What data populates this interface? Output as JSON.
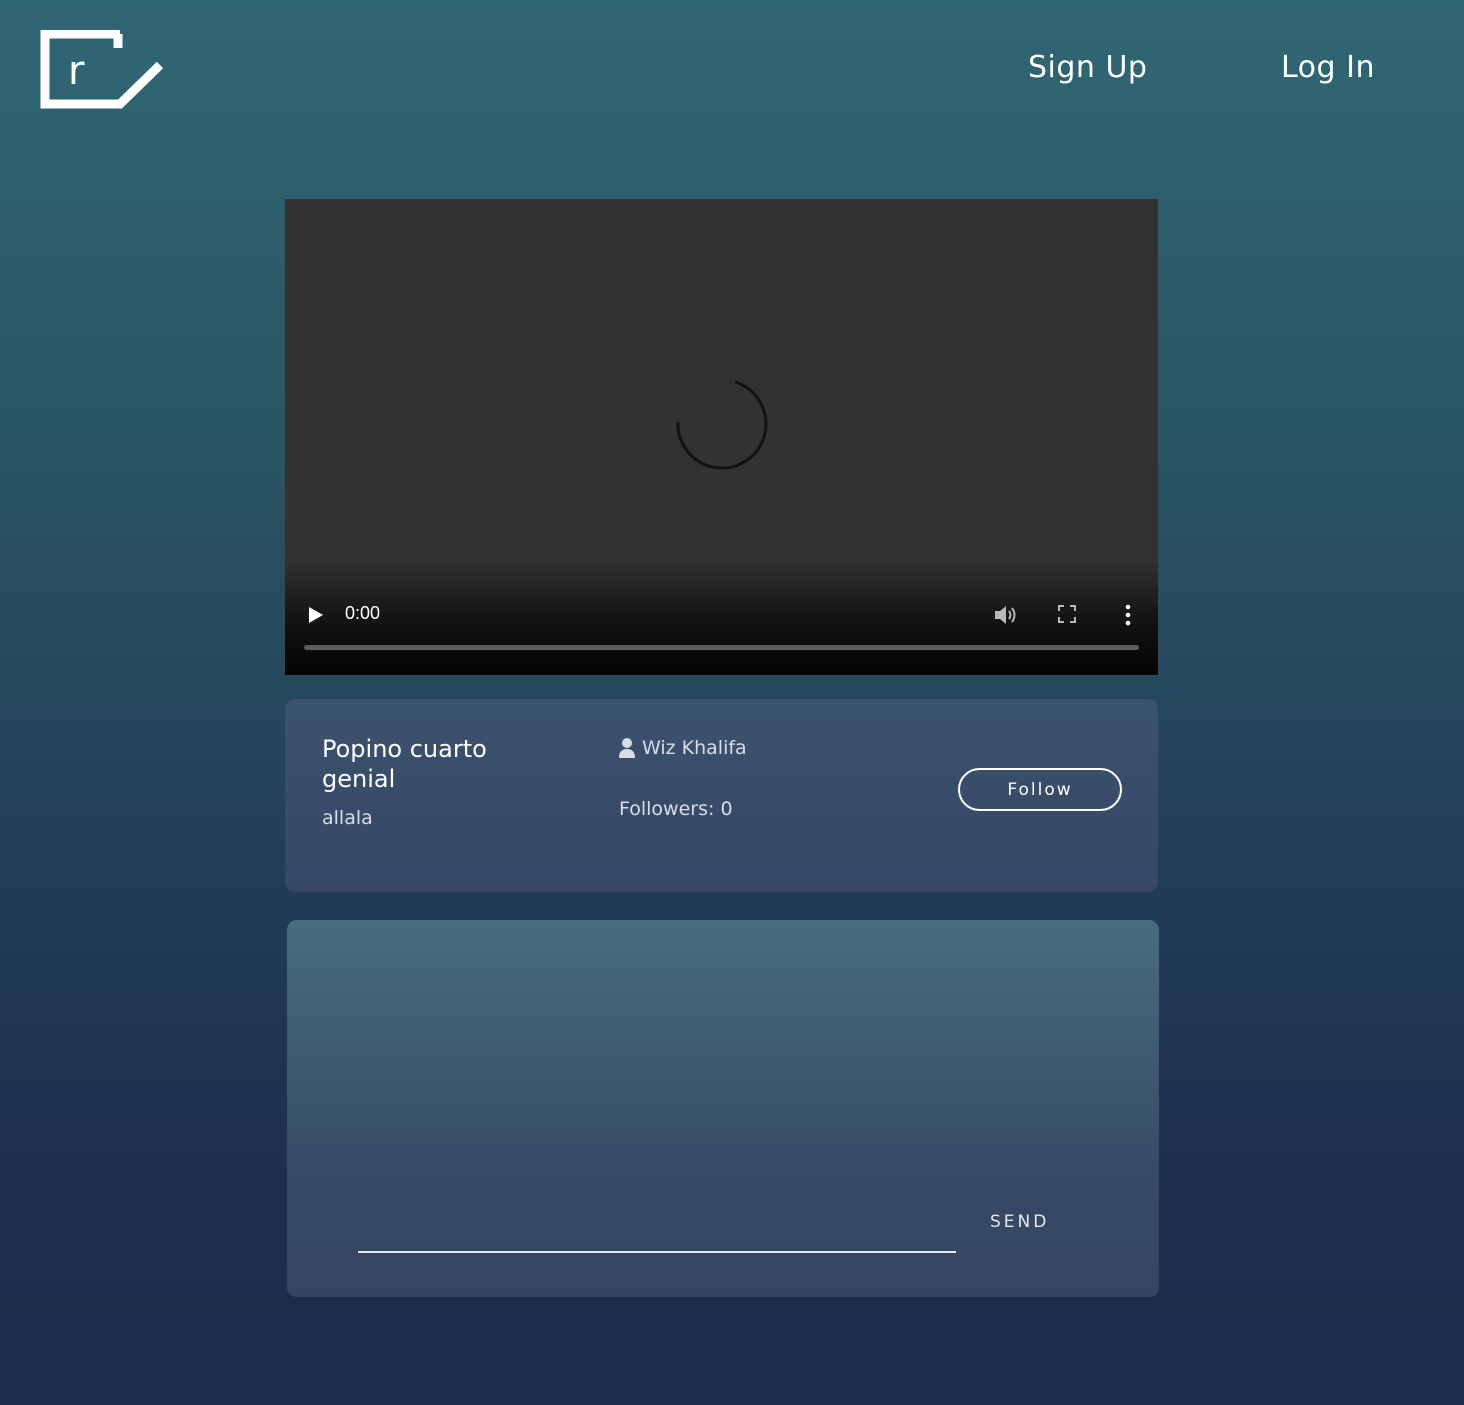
{
  "header": {
    "logo_icon": "brand-logo-icon",
    "signup_label": "Sign Up",
    "login_label": "Log In"
  },
  "video_player": {
    "state": "loading",
    "current_time": "0:00",
    "progress": 0,
    "icons": {
      "play": "play-icon",
      "volume": "volume-icon",
      "fullscreen": "fullscreen-icon",
      "more": "more-vertical-icon",
      "spinner": "loading-spinner-icon"
    }
  },
  "video_info": {
    "title": "Popino cuarto genial",
    "description": "allala",
    "author_icon": "user-icon",
    "author": "Wiz Khalifa",
    "followers": "Followers: 0",
    "follow_label": "Follow"
  },
  "chat": {
    "input_value": "",
    "send_label": "SEND"
  },
  "colors": {
    "background_top": "#306775",
    "background_bottom": "#1d2a4b",
    "video_bg": "#323232",
    "card_bg": "#3b526d",
    "text": "#ffffff"
  }
}
